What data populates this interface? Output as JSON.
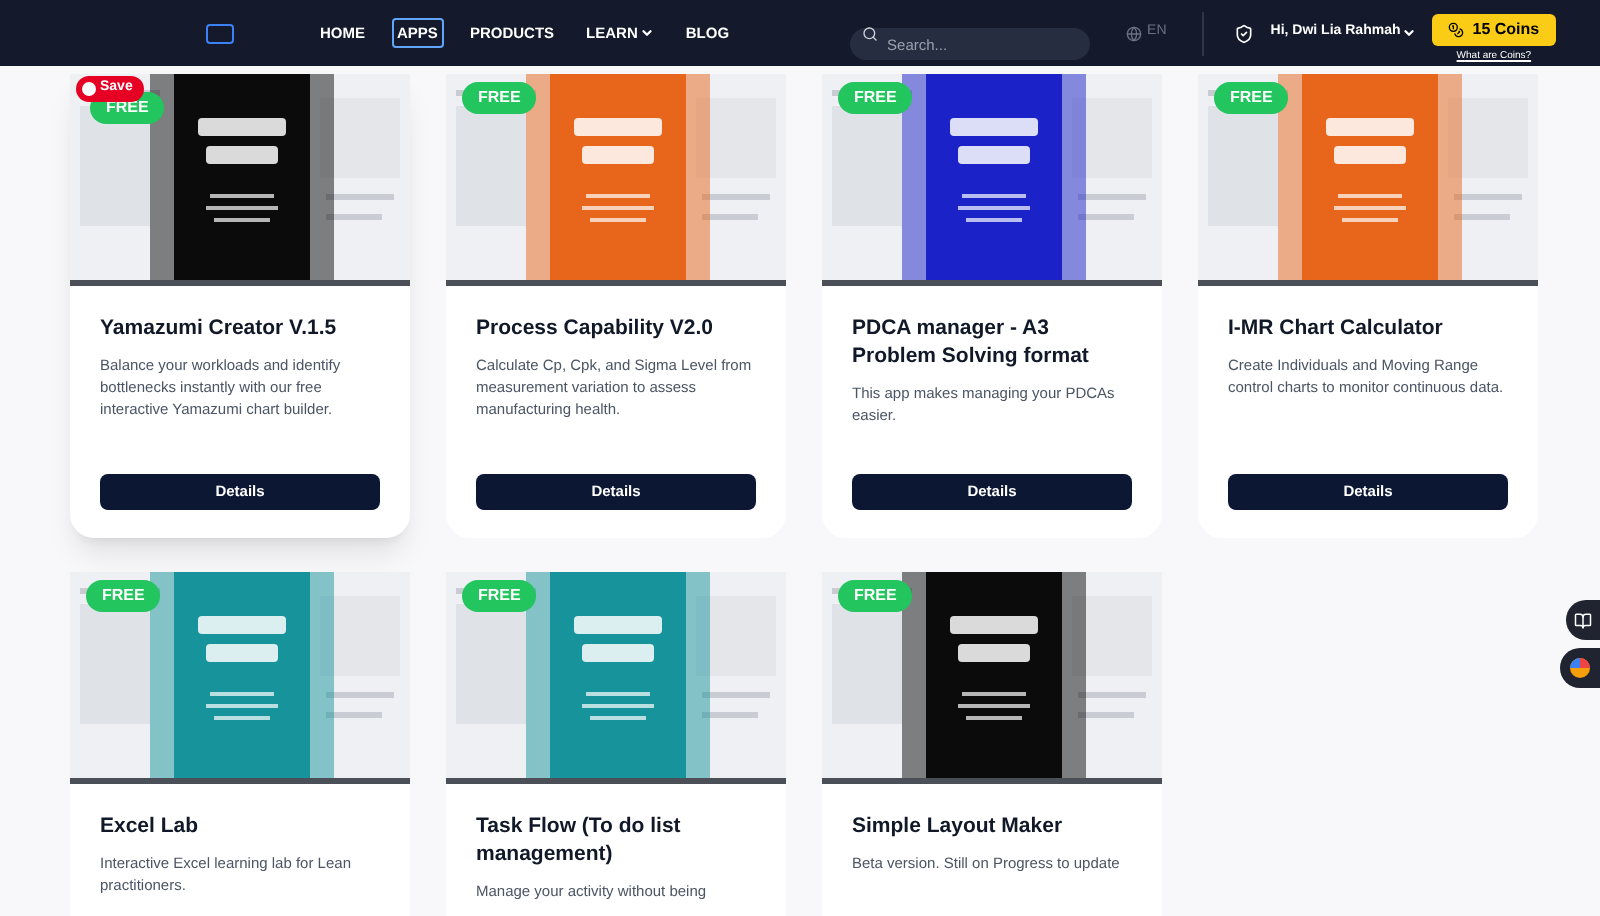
{
  "nav": {
    "links": [
      {
        "label": "HOME",
        "selected": false,
        "dropdown": false
      },
      {
        "label": "APPS",
        "selected": true,
        "dropdown": false
      },
      {
        "label": "PRODUCTS",
        "selected": false,
        "dropdown": false
      },
      {
        "label": "LEARN",
        "selected": false,
        "dropdown": true
      },
      {
        "label": "BLOG",
        "selected": false,
        "dropdown": false
      }
    ],
    "search": {
      "placeholder": "Search..."
    },
    "language": "EN",
    "user": "Hi, Dwi Lia Rahmah",
    "coins": "15 Coins",
    "coins_help": "What are Coins?"
  },
  "save_button": "Save",
  "apps": [
    {
      "badge": "FREE",
      "title": "Yamazumi Creator V.1.5",
      "description": "Balance your workloads and identify bottlenecks instantly with our free interactive Yamazumi chart builder.",
      "button": "Details"
    },
    {
      "badge": "FREE",
      "title": "Process Capability V2.0",
      "description": "Calculate Cp, Cpk, and Sigma Level from measurement variation to assess manufacturing health.",
      "button": "Details"
    },
    {
      "badge": "FREE",
      "title": "PDCA manager - A3 Problem Solving format",
      "description": "This app makes managing your PDCAs easier.",
      "button": "Details"
    },
    {
      "badge": "FREE",
      "title": "I-MR Chart Calculator",
      "description": "Create Individuals and Moving Range control charts to monitor continuous data.",
      "button": "Details"
    },
    {
      "badge": "FREE",
      "title": "Excel Lab",
      "description": "Interactive Excel learning lab for Lean practitioners."
    },
    {
      "badge": "FREE",
      "title": "Task Flow (To do list management)",
      "description": "Manage your activity without being"
    },
    {
      "badge": "FREE",
      "title": "Simple Layout Maker",
      "description": "Beta version. Still on Progress to update"
    }
  ]
}
